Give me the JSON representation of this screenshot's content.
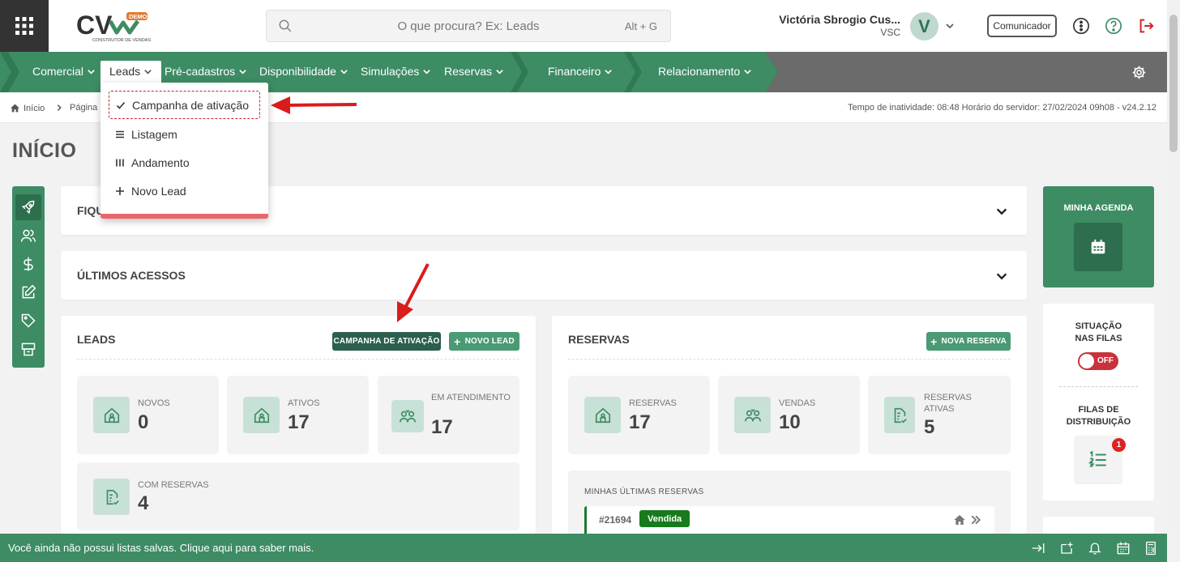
{
  "header": {
    "search_placeholder": "O que procura? Ex: Leads",
    "search_shortcut": "Alt + G",
    "user_name": "Victória Sbrogio Cus...",
    "user_company": "VSC",
    "avatar_letter": "V",
    "comunicador_label": "Comunicador",
    "logo_text": "CV",
    "logo_badge": "DEMO",
    "logo_sub": "CONSTRUTOR DE VENDAS"
  },
  "nav": {
    "items": [
      {
        "label": "Comercial"
      },
      {
        "label": "Leads"
      },
      {
        "label": "Pré-cadastros"
      },
      {
        "label": "Disponibilidade"
      },
      {
        "label": "Simulações"
      },
      {
        "label": "Reservas"
      },
      {
        "label": "Financeiro"
      },
      {
        "label": "Relacionamento"
      }
    ]
  },
  "dropdown": {
    "items": [
      {
        "label": "Campanha de ativação",
        "icon": "check-icon"
      },
      {
        "label": "Listagem",
        "icon": "list-icon"
      },
      {
        "label": "Andamento",
        "icon": "columns-icon"
      },
      {
        "label": "Novo Lead",
        "icon": "plus-icon"
      }
    ]
  },
  "breadcrumb": {
    "home": "Início",
    "page": "Página"
  },
  "server_info": "Tempo de inatividade: 08:48  Horário do servidor: 27/02/2024 09h08 - v24.2.12",
  "page_title": "INÍCIO",
  "cards": {
    "fiquei": "FIQU",
    "ultimos": "ÚLTIMOS ACESSOS"
  },
  "leads": {
    "title": "LEADS",
    "btn_campanha": "CAMPANHA DE ATIVAÇÃO",
    "btn_novo": "NOVO LEAD",
    "stats": [
      {
        "label": "NOVOS",
        "value": "0"
      },
      {
        "label": "ATIVOS",
        "value": "17"
      },
      {
        "label": "EM ATENDIMENTO",
        "value": "17"
      },
      {
        "label": "COM RESERVAS",
        "value": "4"
      }
    ]
  },
  "reservas": {
    "title": "RESERVAS",
    "btn_nova": "NOVA RESERVA",
    "stats": [
      {
        "label": "RESERVAS",
        "value": "17"
      },
      {
        "label": "VENDAS",
        "value": "10"
      },
      {
        "label": "RESERVAS ATIVAS",
        "value": "5"
      }
    ],
    "recent_title": "MINHAS ÚLTIMAS RESERVAS",
    "recent_item": {
      "number": "#21694",
      "status": "Vendida"
    }
  },
  "right": {
    "agenda_title": "MINHA AGENDA",
    "filas_title": "SITUAÇÃO NAS FILAS",
    "toggle_label": "OFF",
    "distrib_title": "FILAS DE DISTRIBUIÇÃO",
    "distrib_badge": "1"
  },
  "bottom": {
    "message": "Você ainda não possui listas salvas. Clique aqui para saber mais."
  },
  "colors": {
    "brand_green": "#3d8c64",
    "dark_green": "#2c6e4d",
    "danger": "#c8323c"
  }
}
